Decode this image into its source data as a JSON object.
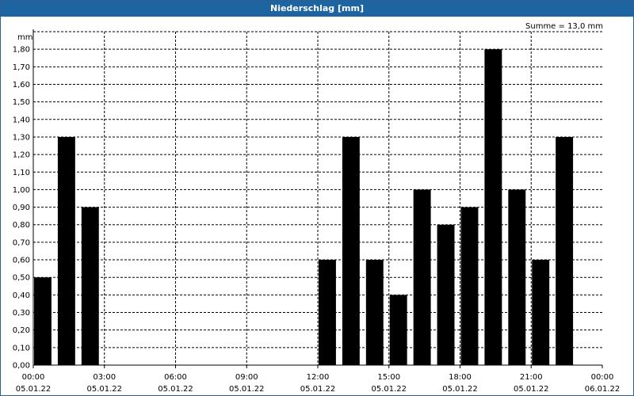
{
  "window": {
    "title": "Niederschlag [mm]"
  },
  "chart_data": {
    "type": "bar",
    "unit_label": "mm",
    "summary": "Summe = 13,0 mm",
    "ylim": [
      0,
      1.9
    ],
    "grid": true,
    "y_ticks": [
      "0,00",
      "0,10",
      "0,20",
      "0,30",
      "0,40",
      "0,50",
      "0,60",
      "0,70",
      "0,80",
      "0,90",
      "1,00",
      "1,10",
      "1,20",
      "1,30",
      "1,40",
      "1,50",
      "1,60",
      "1,70",
      "1,80"
    ],
    "x_ticks": [
      {
        "time": "00:00",
        "date": "05.01.22"
      },
      {
        "time": "03:00",
        "date": "05.01.22"
      },
      {
        "time": "06:00",
        "date": "05.01.22"
      },
      {
        "time": "09:00",
        "date": "05.01.22"
      },
      {
        "time": "12:00",
        "date": "05.01.22"
      },
      {
        "time": "15:00",
        "date": "05.01.22"
      },
      {
        "time": "18:00",
        "date": "05.01.22"
      },
      {
        "time": "21:00",
        "date": "05.01.22"
      },
      {
        "time": "00:00",
        "date": "06.01.22"
      }
    ],
    "bar_color": "#000000",
    "bars": [
      {
        "hour": 0,
        "value": 0.5
      },
      {
        "hour": 1,
        "value": 1.3
      },
      {
        "hour": 2,
        "value": 0.9
      },
      {
        "hour": 3,
        "value": 0
      },
      {
        "hour": 4,
        "value": 0
      },
      {
        "hour": 5,
        "value": 0
      },
      {
        "hour": 6,
        "value": 0
      },
      {
        "hour": 7,
        "value": 0
      },
      {
        "hour": 8,
        "value": 0
      },
      {
        "hour": 9,
        "value": 0
      },
      {
        "hour": 10,
        "value": 0
      },
      {
        "hour": 11,
        "value": 0
      },
      {
        "hour": 12,
        "value": 0.6
      },
      {
        "hour": 13,
        "value": 1.3
      },
      {
        "hour": 14,
        "value": 0.6
      },
      {
        "hour": 15,
        "value": 0.4
      },
      {
        "hour": 16,
        "value": 1.0
      },
      {
        "hour": 17,
        "value": 0.8
      },
      {
        "hour": 18,
        "value": 0.9
      },
      {
        "hour": 19,
        "value": 1.8
      },
      {
        "hour": 20,
        "value": 1.0
      },
      {
        "hour": 21,
        "value": 0.6
      },
      {
        "hour": 22,
        "value": 1.3
      },
      {
        "hour": 23,
        "value": 0
      }
    ]
  }
}
